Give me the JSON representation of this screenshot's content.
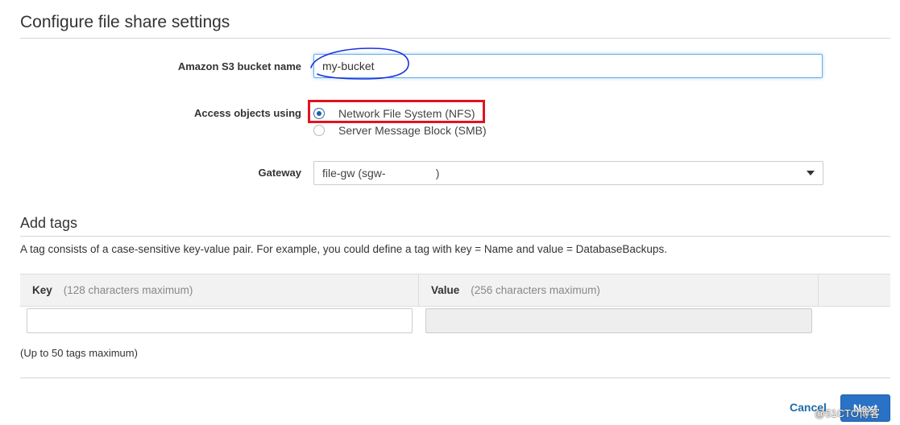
{
  "file_share": {
    "title": "Configure file share settings",
    "bucket_label": "Amazon S3 bucket name",
    "bucket_value": "my-bucket",
    "access_label": "Access objects using",
    "access_options": [
      {
        "label": "Network File System (NFS)",
        "selected": true
      },
      {
        "label": "Server Message Block (SMB)",
        "selected": false
      }
    ],
    "gateway_label": "Gateway",
    "gateway_value": "file-gw (sgw-                )"
  },
  "tags": {
    "title": "Add tags",
    "description": "A tag consists of a case-sensitive key-value pair. For example, you could define a tag with key = Name and value = DatabaseBackups.",
    "columns": [
      {
        "name": "Key",
        "hint": "(128 characters maximum)"
      },
      {
        "name": "Value",
        "hint": "(256 characters maximum)"
      }
    ],
    "key_value": "",
    "value_value": "",
    "limit_note": "(Up to 50 tags maximum)"
  },
  "footer": {
    "cancel_label": "Cancel",
    "next_label": "Next"
  },
  "watermark": "@51CTO博客",
  "colors": {
    "annotation_highlight": "#e0141e",
    "annotation_scribble": "#1a2fe0",
    "primary_button": "#2a72c5",
    "link": "#1f6aa8"
  }
}
